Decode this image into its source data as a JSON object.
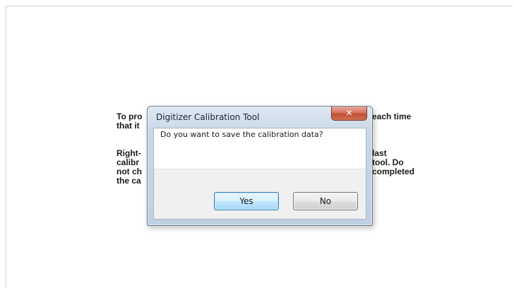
{
  "background": {
    "left_lines": [
      "To pro",
      "that it",
      "",
      "Right-",
      "calibr",
      "not ch",
      "the ca"
    ],
    "right_lines": [
      "each time",
      "",
      "",
      "last",
      "tool. Do",
      "completed",
      ""
    ]
  },
  "dialog": {
    "title": "Digitizer Calibration Tool",
    "close_label": "✕",
    "message": "Do you want to save the calibration data?",
    "yes_label": "Yes",
    "no_label": "No"
  },
  "colors": {
    "default_button_border": "#3c7fb1",
    "close_button": "#c14f36",
    "title_bar": "#c9d8e7"
  }
}
